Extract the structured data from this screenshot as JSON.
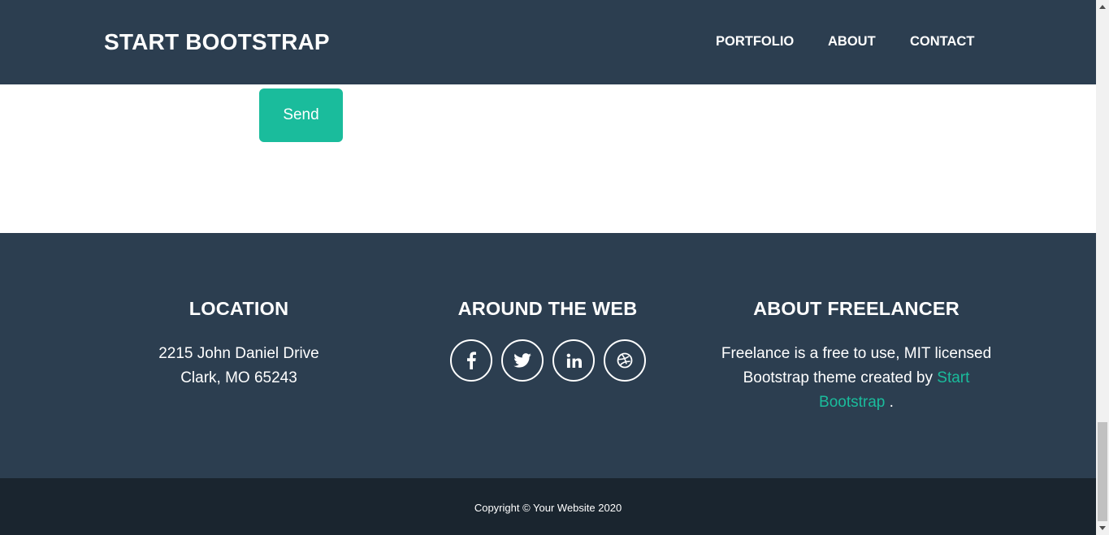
{
  "navbar": {
    "brand": "START BOOTSTRAP",
    "links": [
      {
        "label": "PORTFOLIO"
      },
      {
        "label": "ABOUT"
      },
      {
        "label": "CONTACT"
      }
    ]
  },
  "contact": {
    "send_label": "Send"
  },
  "footer": {
    "location": {
      "heading": "LOCATION",
      "line1": "2215 John Daniel Drive",
      "line2": "Clark, MO 65243"
    },
    "web": {
      "heading": "AROUND THE WEB",
      "icons": [
        "facebook-icon",
        "twitter-icon",
        "linkedin-icon",
        "dribbble-icon"
      ]
    },
    "about": {
      "heading": "ABOUT FREELANCER",
      "text": "Freelance is a free to use, MIT licensed Bootstrap theme created by",
      "link": "Start Bootstrap",
      "suffix": "."
    }
  },
  "copyright": "Copyright © Your Website 2020",
  "colors": {
    "primary": "#2c3e50",
    "accent": "#1abc9c",
    "copyright_bg": "#1a252f"
  }
}
